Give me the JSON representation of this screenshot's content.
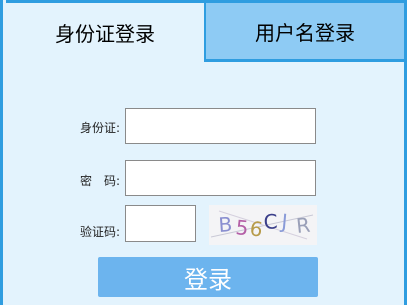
{
  "tabs": [
    {
      "label": "身份证登录",
      "active": true
    },
    {
      "label": "用户名登录",
      "active": false
    }
  ],
  "form": {
    "id_label": "身份证:",
    "id_value": "",
    "password_label": "密　码:",
    "password_value": "",
    "captcha_label": "验证码:",
    "captcha_value": "",
    "captcha_text": "B56CJR",
    "captcha_chars": [
      "B",
      "5",
      "6",
      "C",
      "J",
      "R"
    ],
    "captcha_colors": [
      "#8a8fd0",
      "#b45fa6",
      "#b79b4a",
      "#3b3f8a",
      "#8a9bd8",
      "#9aa0b8"
    ]
  },
  "login_button": "登录",
  "colors": {
    "border": "#2f9de0",
    "panel": "#e3f3fd",
    "inactive_tab": "#8ecbf4",
    "button": "#6cb4ee"
  }
}
